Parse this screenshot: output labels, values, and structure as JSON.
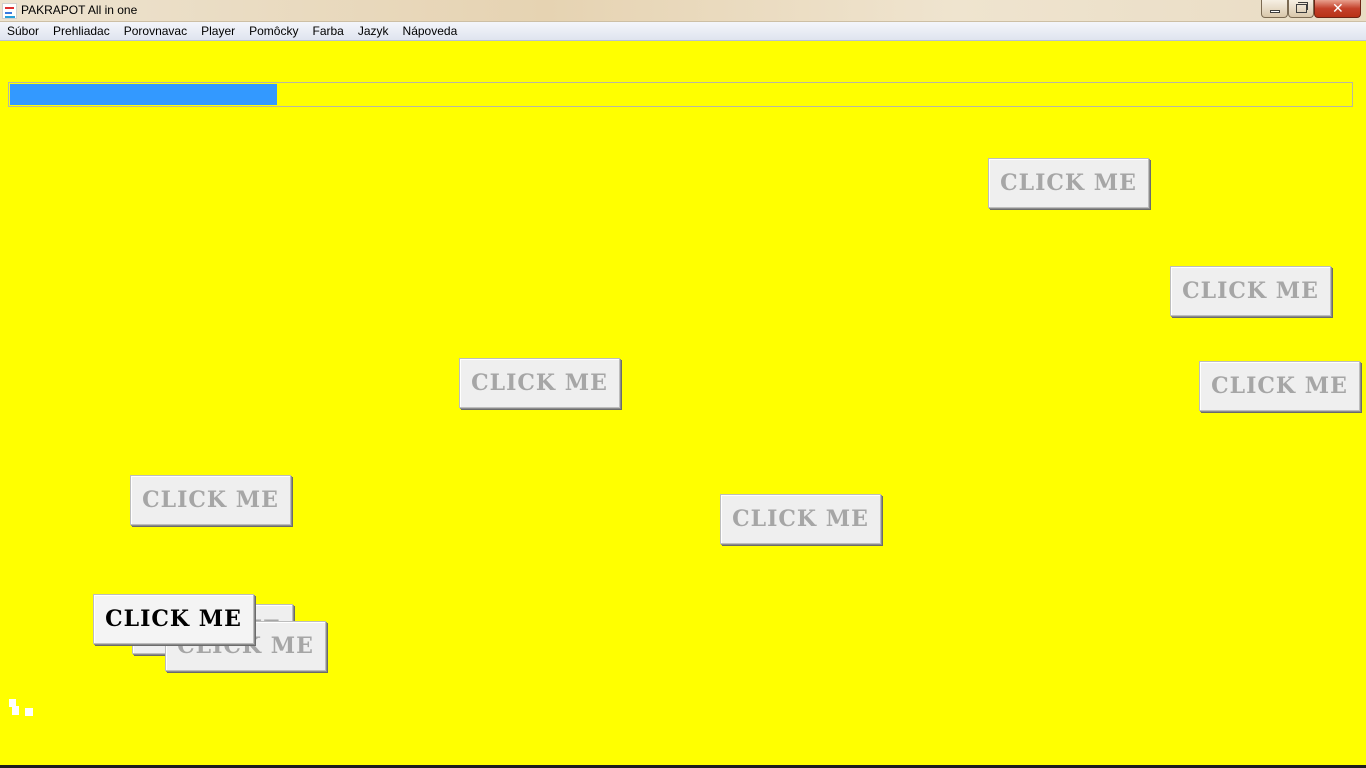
{
  "window": {
    "title": "PAKRAPOT All in one"
  },
  "menu": {
    "items": [
      "Súbor",
      "Prehliadac",
      "Porovnavac",
      "Player",
      "Pomôcky",
      "Farba",
      "Jazyk",
      "Nápoveda"
    ]
  },
  "progress": {
    "value_fraction": 0.2
  },
  "buttons": {
    "label": "CLICK ME",
    "active_label": "CLICK ME"
  },
  "colors": {
    "background": "#ffff00",
    "progress_fill": "#3399ff",
    "button_inactive_text": "#a6a6a6",
    "button_active_text": "#000000"
  },
  "icons": [
    "app-icon",
    "minimize-icon",
    "maximize-icon",
    "close-icon"
  ]
}
